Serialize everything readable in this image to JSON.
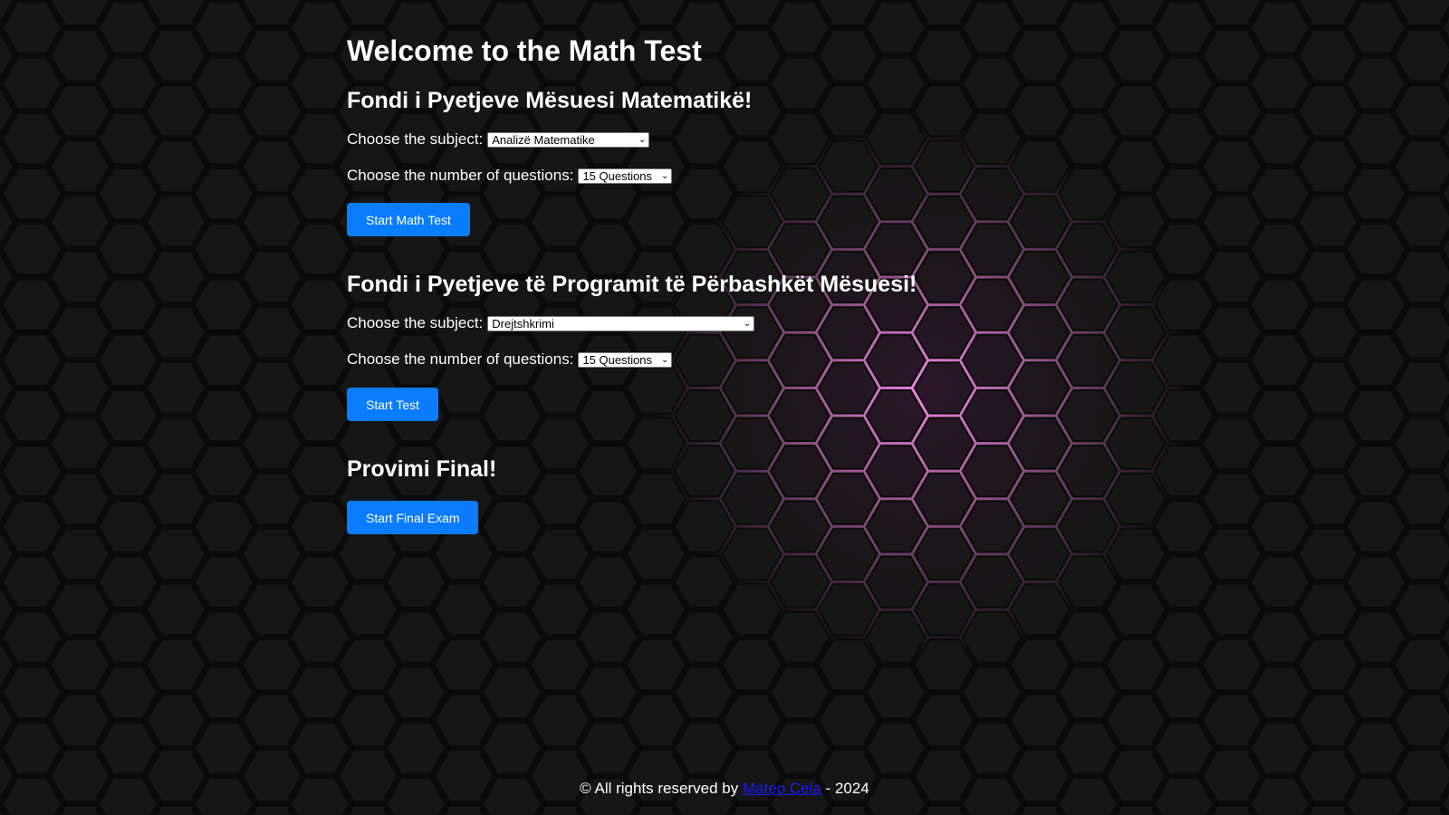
{
  "header": {
    "title": "Welcome to the Math Test"
  },
  "math_section": {
    "heading": "Fondi i Pyetjeve Mësuesi Matematikë!",
    "subject_label": "Choose the subject:",
    "subject_selected": "Analizë Matematike",
    "count_label": "Choose the number of questions:",
    "count_selected": "15 Questions",
    "start_label": "Start Math Test"
  },
  "common_section": {
    "heading": "Fondi i Pyetjeve të Programit të Përbashkët Mësuesi!",
    "subject_label": "Choose the subject:",
    "subject_selected": "Drejtshkrimi",
    "count_label": "Choose the number of questions:",
    "count_selected": "15 Questions",
    "start_label": "Start Test"
  },
  "final_section": {
    "heading": "Provimi Final!",
    "start_label": "Start Final Exam"
  },
  "footer": {
    "prefix": "© All rights reserved by ",
    "author": "Mateo Cela",
    "suffix": " - 2024"
  },
  "colors": {
    "background": "#161616",
    "hex_line": "#0b0b0b",
    "glow": "#ff8cf0",
    "button": "#0a7cff",
    "link": "#1a1aff"
  }
}
